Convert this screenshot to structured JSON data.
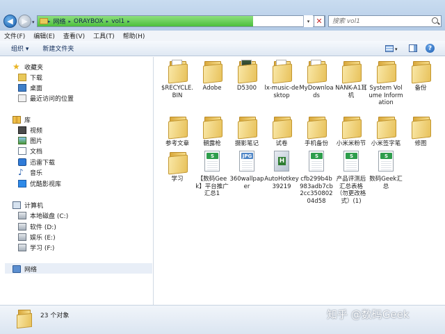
{
  "address": {
    "crumbs": [
      "网络",
      "ORAYBOX",
      "vol1"
    ],
    "search_placeholder": "搜索 vol1"
  },
  "menu": [
    "文件(F)",
    "编辑(E)",
    "查看(V)",
    "工具(T)",
    "帮助(H)"
  ],
  "toolbar": {
    "organize": "组织 ▾",
    "new_folder": "新建文件夹"
  },
  "sidebar": {
    "favorites": {
      "label": "收藏夹",
      "items": [
        "下载",
        "桌面",
        "最近访问的位置"
      ]
    },
    "libraries": {
      "label": "库",
      "items": [
        "视频",
        "图片",
        "文档",
        "迅雷下载",
        "音乐",
        "优酷影视库"
      ]
    },
    "computer": {
      "label": "计算机",
      "items": [
        "本地磁盘 (C:)",
        "软件 (D:)",
        "娱乐 (E:)",
        "学习 (F:)"
      ]
    },
    "network": {
      "label": "网络"
    }
  },
  "files": [
    {
      "name": "$RECYCLE.BIN",
      "type": "folder"
    },
    {
      "name": "Adobe",
      "type": "folder"
    },
    {
      "name": "D5300",
      "type": "folder-dark"
    },
    {
      "name": "lx-music-desktop",
      "type": "folder-paper"
    },
    {
      "name": "MyDownloads",
      "type": "folder-red"
    },
    {
      "name": "NANK-A1耳机",
      "type": "folder"
    },
    {
      "name": "System Volume Information",
      "type": "folder"
    },
    {
      "name": "备份",
      "type": "folder"
    },
    {
      "name": "参考文章",
      "type": "folder"
    },
    {
      "name": "朝露枪",
      "type": "folder"
    },
    {
      "name": "摄影笔记",
      "type": "folder"
    },
    {
      "name": "试卷",
      "type": "folder"
    },
    {
      "name": "手机备份",
      "type": "folder"
    },
    {
      "name": "小米米粉节",
      "type": "folder"
    },
    {
      "name": "小米签字笔",
      "type": "folder"
    },
    {
      "name": "修图",
      "type": "folder"
    },
    {
      "name": "学习",
      "type": "folder"
    },
    {
      "name": "【数码Geek】平台推广汇总1",
      "type": "xls"
    },
    {
      "name": "360wallpaper",
      "type": "jpg"
    },
    {
      "name": "AutoHotkey39219",
      "type": "ahk"
    },
    {
      "name": "cfb299b4b983adb7cb2cc35080204d58",
      "type": "xls"
    },
    {
      "name": "产品评测后汇总表格（勿更改格式）(1)",
      "type": "xls"
    },
    {
      "name": "数码Geek汇总",
      "type": "xls"
    }
  ],
  "status": {
    "count": "23 个对象"
  },
  "watermark": "知乎 @数码Geek",
  "colors": {
    "address_fill": "#4cbf3c",
    "toolbar_bg": "#dfe8f3",
    "folder": "#e8c25c"
  }
}
